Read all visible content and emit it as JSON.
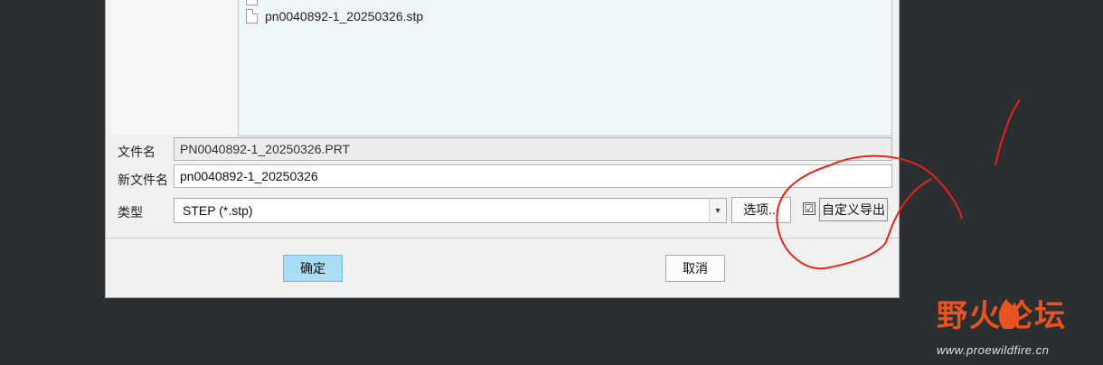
{
  "file_list": {
    "items": [
      {
        "name": "pn0040892-1_20250326.stp"
      }
    ]
  },
  "form": {
    "file_name_label": "文件名",
    "file_name_value": "PN0040892-1_20250326.PRT",
    "new_file_name_label": "新文件名",
    "new_file_name_value": "pn0040892-1_20250326",
    "type_label": "类型",
    "type_value": "STEP (*.stp)",
    "options_button": "选项...",
    "custom_export_label": "自定义导出",
    "custom_export_checked": "☑"
  },
  "footer": {
    "ok_button": "确定",
    "cancel_button": "取消"
  },
  "watermark": {
    "title": "野火论坛",
    "url": "www.proewildfire.cn"
  },
  "colors": {
    "background": "#2b2f31",
    "primary_button": "#a9dcf5",
    "annotation": "#e8231a",
    "watermark": "#e8531f"
  }
}
